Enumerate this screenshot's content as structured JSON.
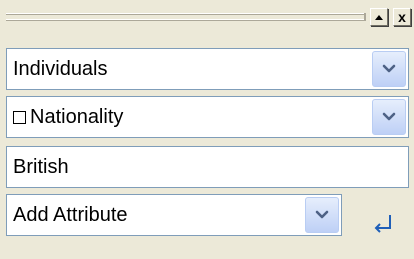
{
  "titlebar": {
    "up_icon": "scroll-up-icon",
    "close_icon": "close-icon",
    "close_glyph": "x"
  },
  "fields": {
    "category": {
      "value": "Individuals",
      "icon": "chevron-down-icon"
    },
    "attribute_filter": {
      "value": "Nationality",
      "icon": "chevron-down-icon",
      "checkbox_icon": "checkbox-icon"
    },
    "attribute_value": {
      "value": "British"
    },
    "add_attribute": {
      "value": "Add Attribute",
      "icon": "chevron-down-icon",
      "enter_icon": "enter-icon"
    }
  },
  "colors": {
    "panel_bg": "#ece9d8",
    "field_border": "#7f9db9",
    "dropdown_button": "#bed0f6",
    "chevron": "#4d6185",
    "enter_icon": "#1f5fb8"
  }
}
